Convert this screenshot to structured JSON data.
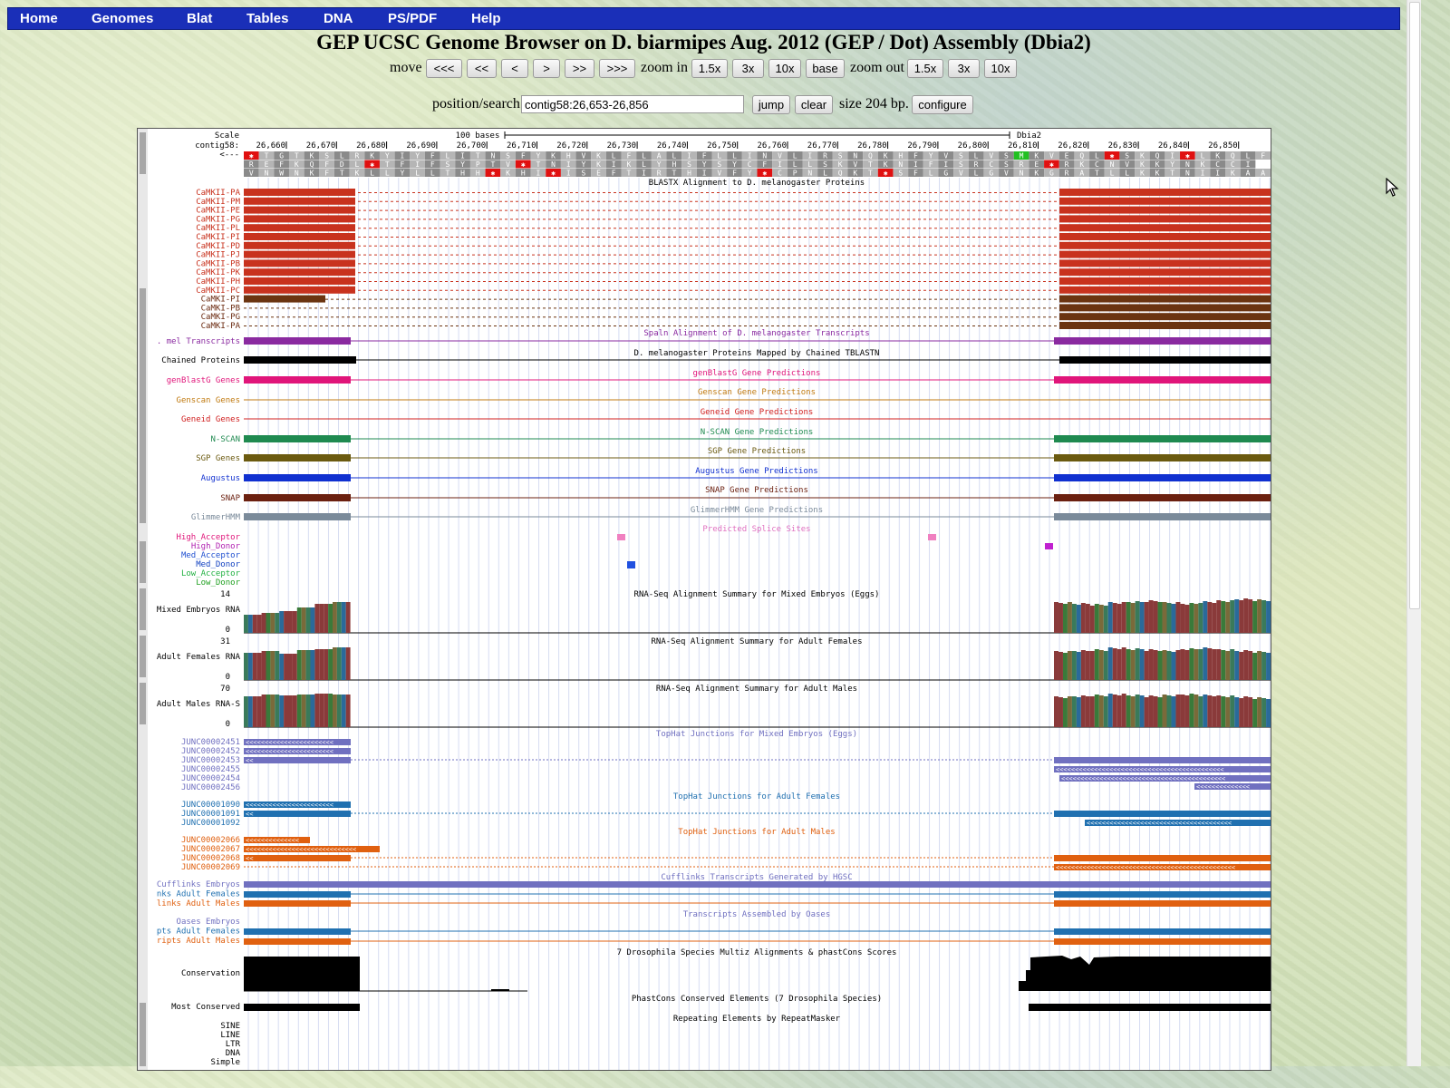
{
  "nav": {
    "home": "Home",
    "genomes": "Genomes",
    "blat": "Blat",
    "tables": "Tables",
    "dna": "DNA",
    "pspdf": "PS/PDF",
    "help": "Help"
  },
  "title": "GEP UCSC Genome Browser on D. biarmipes Aug. 2012 (GEP / Dot) Assembly (Dbia2)",
  "controls": {
    "move_label": "move",
    "move_buttons": [
      "<<<",
      "<<",
      "<",
      ">",
      ">>",
      ">>>"
    ],
    "zoom_in_label": "zoom in",
    "zoom_in_buttons": [
      "1.5x",
      "3x",
      "10x",
      "base"
    ],
    "zoom_out_label": "zoom out",
    "zoom_out_buttons": [
      "1.5x",
      "3x",
      "10x"
    ],
    "position_label": "position/search",
    "position_value": "contig58:26,653-26,856",
    "jump": "jump",
    "clear": "clear",
    "size_text": "size 204 bp.",
    "configure": "configure"
  },
  "ruler": {
    "scale_label": "Scale",
    "scale_bar_text": "100 bases",
    "assembly": "Dbia2",
    "chrom_label": "contig58:",
    "strand_label": "<---",
    "ticks": [
      "26,660",
      "26,670",
      "26,680",
      "26,690",
      "26,700",
      "26,710",
      "26,720",
      "26,730",
      "26,740",
      "26,750",
      "26,760",
      "26,770",
      "26,780",
      "26,790",
      "26,800",
      "26,810",
      "26,820",
      "26,830",
      "26,840",
      "26,850"
    ],
    "frame1": "*TGTKSLRKYIYFLITNSFYKHVKLFLALIFLLINVLIRSNQKHFYVSLVSMKVEQL*SKQI*LKQLF",
    "frame2": "REFKQFDL*TFIFSYPTV*TNIYKIKLYHSYSYCFILLSKVTKNIFISRCSRE*RKCNVKKYNKCCI",
    "frame3": "VNWNKFTKLLYLLTHH*KHI*ISEFTIRTHIVFY*CPNLQKT*SFLGVLGVNKGRATLLKKTNIIKAAF"
  },
  "track_titles": {
    "blastx": "BLASTX Alignment to D. melanogaster Proteins",
    "spaln": "Spaln Alignment of D. melanogaster Transcripts",
    "chained": "D. melanogaster Proteins Mapped by Chained TBLASTN",
    "genblastg": "genBlastG Gene Predictions",
    "genscan": "Genscan Gene Predictions",
    "geneid": "Geneid Gene Predictions",
    "nscan": "N-SCAN Gene Predictions",
    "sgp": "SGP Gene Predictions",
    "augustus": "Augustus Gene Predictions",
    "snap": "SNAP Gene Predictions",
    "glimmer": "GlimmerHMM Gene Predictions",
    "splice": "Predicted Splice Sites",
    "rnaseq_emb": "RNA-Seq Alignment Summary for Mixed Embryos (Eggs)",
    "rnaseq_fem": "RNA-Seq Alignment Summary for Adult Females",
    "rnaseq_male": "RNA-Seq Alignment Summary for Adult Males",
    "tophat_emb": "TopHat Junctions for Mixed Embryos (Eggs)",
    "tophat_fem": "TopHat Junctions for Adult Females",
    "tophat_male": "TopHat Junctions for Adult Males",
    "cufflinks": "Cufflinks Transcripts Generated by HGSC",
    "oases": "Transcripts Assembled by Oases",
    "multiz": "7 Drosophila Species Multiz Alignments & phastCons Scores",
    "phastcons_el": "PhastCons Conserved Elements (7 Drosophila Species)",
    "repeats": "Repeating Elements by RepeatMasker"
  },
  "labels": {
    "blastx": [
      "CaMKII-PA",
      "CaMKII-PM",
      "CaMKII-PE",
      "CaMKII-PG",
      "CaMKII-PL",
      "CaMKII-PI",
      "CaMKII-PD",
      "CaMKII-PJ",
      "CaMKII-PB",
      "CaMKII-PK",
      "CaMKII-PH",
      "CaMKII-PC",
      "CaMKI-PI",
      "CaMKI-PB",
      "CaMKI-PG",
      "CaMKI-PA"
    ],
    "spaln": ". mel Transcripts",
    "chained": "Chained Proteins",
    "genblastg": "genBlastG Genes",
    "genscan": "Genscan Genes",
    "geneid": "Geneid Genes",
    "nscan": "N-SCAN",
    "sgp": "SGP Genes",
    "augustus": "Augustus",
    "snap": "SNAP",
    "glimmer": "GlimmerHMM",
    "splice": [
      "High_Acceptor",
      "High_Donor",
      "Med_Acceptor",
      "Med_Donor",
      "Low_Acceptor",
      "Low_Donor"
    ],
    "rnaseq_emb": "Mixed Embryos RNA",
    "rnaseq_fem": "Adult Females RNA",
    "rnaseq_male": "Adult Males RNA-S",
    "rnaseq_max": [
      "14",
      "31",
      "70"
    ],
    "rnaseq_min": "0",
    "tophat_emb": [
      "JUNC00002451",
      "JUNC00002452",
      "JUNC00002453",
      "JUNC00002455",
      "JUNC00002454",
      "JUNC00002456"
    ],
    "tophat_fem": [
      "JUNC00001090",
      "JUNC00001091",
      "JUNC00001092"
    ],
    "tophat_male": [
      "JUNC00002066",
      "JUNC00002067",
      "JUNC00002068",
      "JUNC00002069"
    ],
    "cufflinks": [
      "Cufflinks Embryos",
      "nks Adult Females",
      "links Adult Males"
    ],
    "oases": [
      "Oases Embryos",
      "pts Adult Females",
      "ripts Adult Males"
    ],
    "conservation": "Conservation",
    "most_conserved": "Most Conserved",
    "repeats": [
      "SINE",
      "LINE",
      "LTR",
      "DNA",
      "Simple"
    ]
  },
  "colors": {
    "nav_bg": "#1a2fb8",
    "camkii": "#c8321e",
    "camki": "#6b3410",
    "spaln": "#8a2aa0",
    "chained": "#000000",
    "genblastg": "#e0157a",
    "genscan": "#c07a10",
    "geneid": "#d02020",
    "nscan": "#1f8a50",
    "sgp": "#6b5a10",
    "augustus": "#1030d0",
    "snap": "#6b2010",
    "glimmer": "#7a8a9a",
    "tophat_emb": "#7070c0",
    "tophat_fem": "#2070b0",
    "tophat_male": "#e06010"
  }
}
